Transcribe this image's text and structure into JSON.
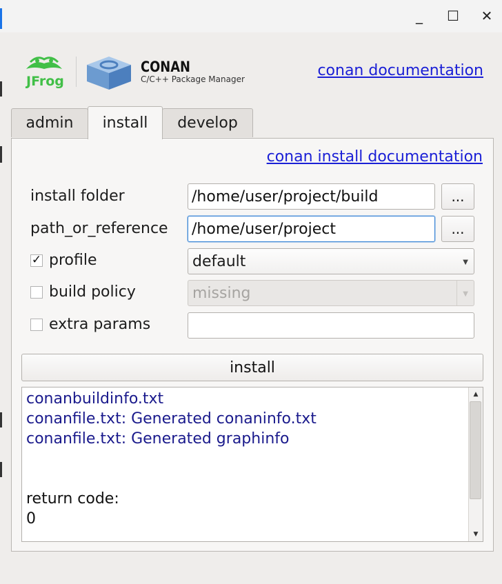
{
  "window": {
    "minimize_glyph": "_",
    "maximize_glyph": "☐",
    "close_glyph": "✕"
  },
  "header": {
    "jfrog_logo_text": "JFrog",
    "brand_title": "CONAN",
    "brand_subtitle": "C/C++ Package Manager",
    "doc_link": "conan documentation"
  },
  "tabs": [
    {
      "label": "admin",
      "active": false
    },
    {
      "label": "install",
      "active": true
    },
    {
      "label": "develop",
      "active": false
    }
  ],
  "install": {
    "doc_link": "conan install documentation",
    "install_folder": {
      "label": "install folder",
      "value": "/home/user/project/build",
      "browse_label": "..."
    },
    "path_or_reference": {
      "label": "path_or_reference",
      "value": "/home/user/project",
      "browse_label": "..."
    },
    "profile": {
      "label": "profile",
      "checked": true,
      "check_glyph": "✓",
      "value": "default"
    },
    "build_policy": {
      "label": "build policy",
      "checked": false,
      "value": "missing",
      "enabled": false
    },
    "extra_params": {
      "label": "extra params",
      "checked": false,
      "value": ""
    },
    "install_button": "install",
    "output_lines": [
      {
        "text": "conanbuildinfo.txt",
        "color": "#1a1a8c"
      },
      {
        "text": "conanfile.txt: Generated conaninfo.txt",
        "color": "#1a1a8c"
      },
      {
        "text": "conanfile.txt: Generated graphinfo",
        "color": "#1a1a8c"
      },
      {
        "text": "",
        "color": "#111111"
      },
      {
        "text": "",
        "color": "#111111"
      },
      {
        "text": "return code:",
        "color": "#111111"
      },
      {
        "text": "0",
        "color": "#111111"
      }
    ]
  },
  "colors": {
    "link": "#1a1fd6",
    "output_blue": "#1a1a8c",
    "focus": "#3b86d6",
    "jfrog_green": "#41bf47",
    "conan_blue": "#6c9bd0"
  }
}
